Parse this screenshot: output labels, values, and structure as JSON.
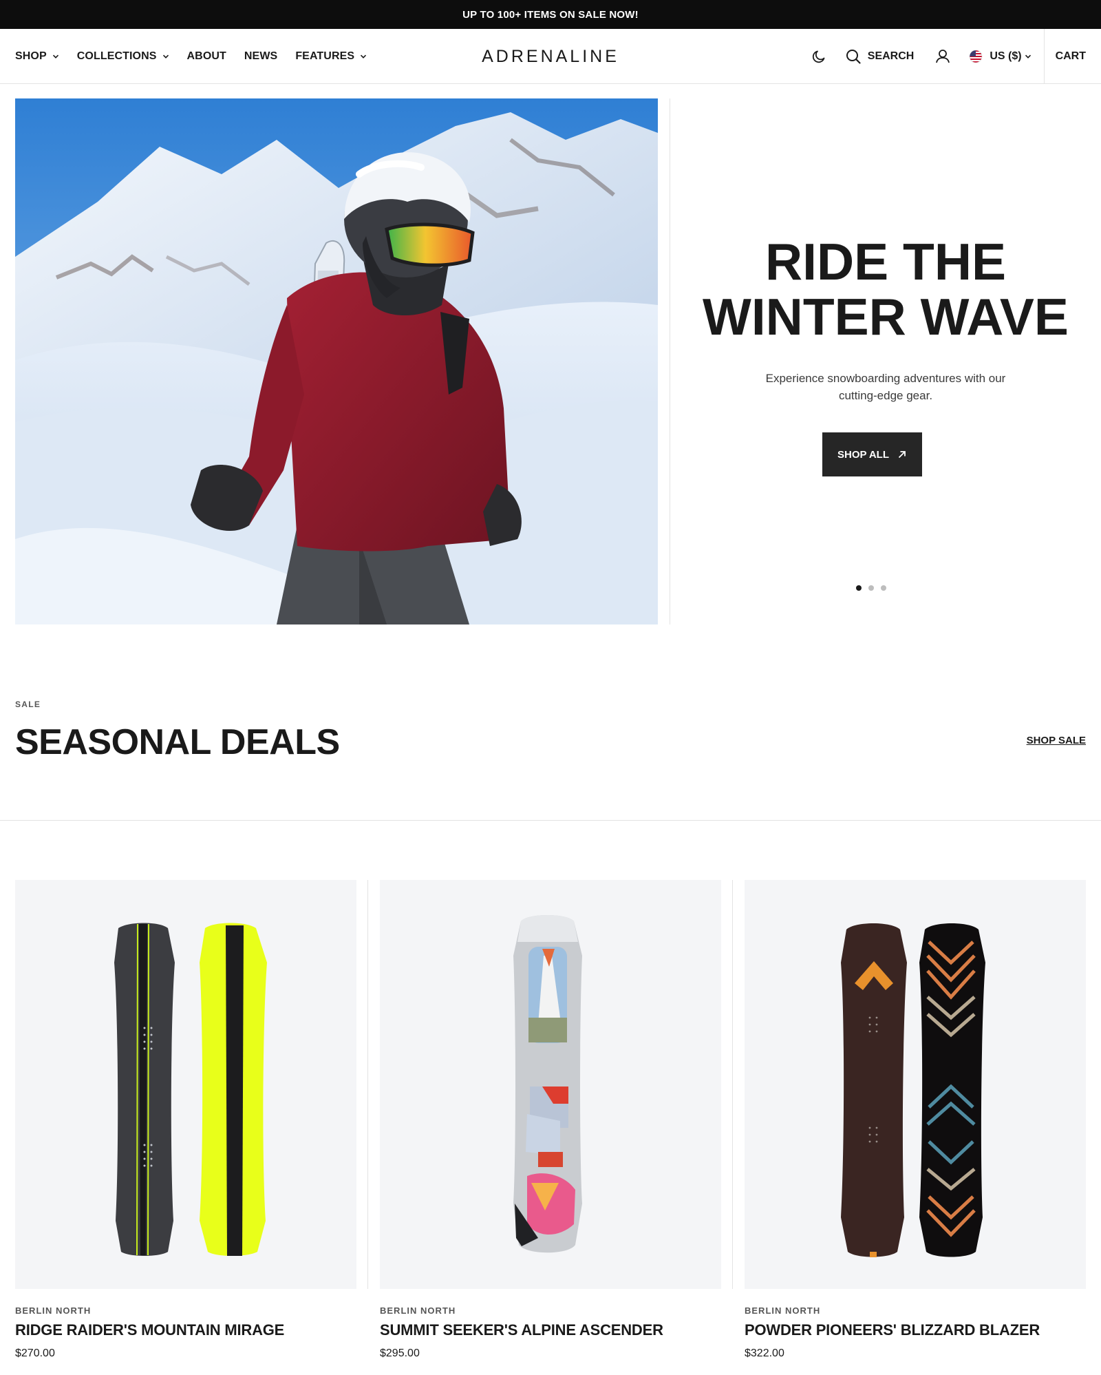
{
  "announcement": "UP TO 100+ ITEMS ON SALE NOW!",
  "nav": {
    "items": [
      {
        "label": "SHOP",
        "dropdown": true
      },
      {
        "label": "COLLECTIONS",
        "dropdown": true
      },
      {
        "label": "ABOUT",
        "dropdown": false
      },
      {
        "label": "NEWS",
        "dropdown": false
      },
      {
        "label": "FEATURES",
        "dropdown": true
      }
    ]
  },
  "logo": "ADRENALINE",
  "tools": {
    "search_label": "SEARCH",
    "currency_label": "US ($)",
    "cart_label": "CART"
  },
  "hero": {
    "title_line1": "RIDE THE",
    "title_line2": "WINTER WAVE",
    "subtitle": "Experience snowboarding adventures with our cutting-edge gear.",
    "cta_label": "SHOP ALL",
    "slides": 3,
    "active_slide": 1
  },
  "section": {
    "eyebrow": "SALE",
    "title": "SEASONAL DEALS",
    "link_label": "SHOP SALE"
  },
  "products": [
    {
      "brand": "BERLIN NORTH",
      "name": "RIDGE RAIDER'S MOUNTAIN MIRAGE",
      "price": "$270.00"
    },
    {
      "brand": "BERLIN NORTH",
      "name": "SUMMIT SEEKER'S ALPINE ASCENDER",
      "price": "$295.00"
    },
    {
      "brand": "BERLIN NORTH",
      "name": "POWDER PIONEERS' BLIZZARD BLAZER",
      "price": "$322.00"
    }
  ],
  "colors": {
    "announcement_bg": "#0d0d0d",
    "button_bg": "#262626",
    "card_bg": "#f4f5f7",
    "accent_yellow": "#e8ff1a"
  },
  "icons": [
    "chevron-down-icon",
    "moon-icon",
    "search-icon",
    "user-icon",
    "us-flag-icon",
    "arrow-up-right-icon"
  ]
}
